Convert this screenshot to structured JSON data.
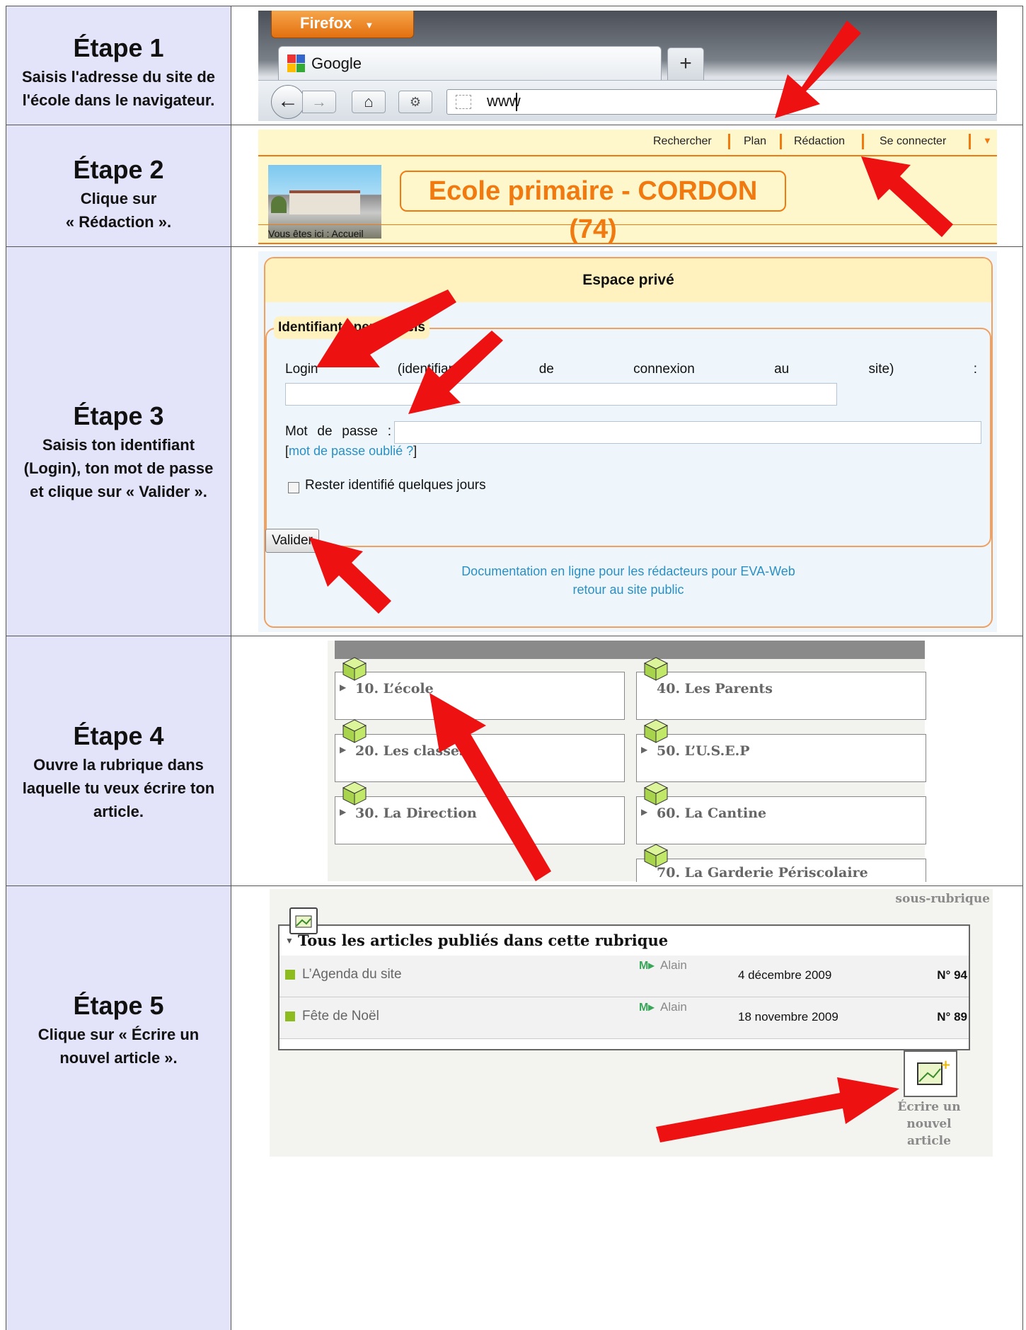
{
  "steps": [
    {
      "title": "Étape 1",
      "desc_lines": [
        "Saisis l'adresse du site de",
        "l'école dans le navigateur."
      ]
    },
    {
      "title": "Étape 2",
      "desc_lines": [
        "Clique sur",
        "« Rédaction »."
      ]
    },
    {
      "title": "Étape 3",
      "desc_lines": [
        "Saisis ton identifiant",
        "(Login), ton mot de passe",
        "et clique sur « Valider »."
      ]
    },
    {
      "title": "Étape 4",
      "desc_lines": [
        "Ouvre la rubrique dans",
        "laquelle tu veux écrire ton",
        "article."
      ]
    },
    {
      "title": "Étape 5",
      "desc_lines": [
        "Clique sur « Écrire un",
        "nouvel article »."
      ]
    }
  ],
  "browser": {
    "app_button": "Firefox",
    "tab_label": "Google",
    "new_tab": "+",
    "url_value": "www"
  },
  "site": {
    "menu": [
      "Rechercher",
      "Plan",
      "Rédaction",
      "Se connecter"
    ],
    "title": "Ecole primaire - CORDON (74)",
    "breadcrumb": "Vous êtes ici : Accueil"
  },
  "login": {
    "header": "Espace privé",
    "legend": "Identifiants personnels",
    "login_label": "Login (identifiant de connexion au site) :",
    "password_label": "Mot de passe :",
    "forgot": "mot de passe oublié ?",
    "remember": "Rester identifié quelques jours",
    "submit": "Valider",
    "doc_link": "Documentation en ligne pour les rédacteurs pour EVA-Web",
    "back_link": "retour au site public"
  },
  "rubriques": [
    {
      "label": "10. L’école"
    },
    {
      "label": "40. Les Parents"
    },
    {
      "label": "20. Les classes"
    },
    {
      "label": "50. L’U.S.E.P"
    },
    {
      "label": "30. La Direction"
    },
    {
      "label": "60. La Cantine"
    },
    {
      "label": "70. La Garderie Périscolaire"
    }
  ],
  "articles": {
    "corner_label": "sous-rubrique",
    "header": "Tous les articles publiés dans cette rubrique",
    "rows": [
      {
        "title": "L’Agenda du site",
        "author": "Alain",
        "date": "4 décembre 2009",
        "num": "N° 94"
      },
      {
        "title": "Fête de Noël",
        "author": "Alain",
        "date": "18 novembre 2009",
        "num": "N° 89"
      }
    ],
    "new_article": [
      "Écrire un",
      "nouvel",
      "article"
    ]
  },
  "colors": {
    "left_cell": "#e3e3fa",
    "arrow": "#ee1111",
    "site_orange": "#f07a10",
    "link": "#2a8fc4"
  }
}
